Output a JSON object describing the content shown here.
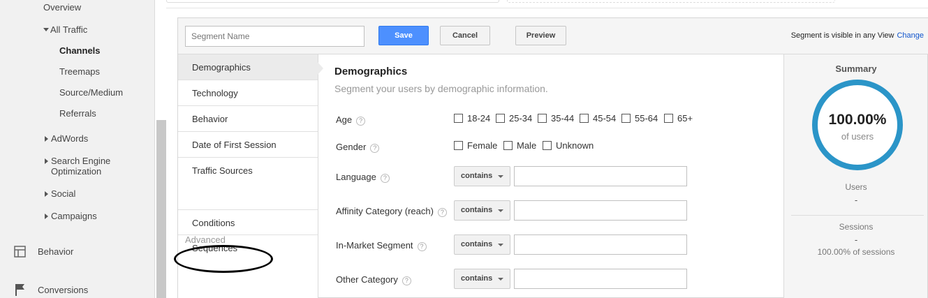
{
  "nav": {
    "overview": "Overview",
    "all_traffic": "All Traffic",
    "channels": "Channels",
    "treemaps": "Treemaps",
    "source_medium": "Source/Medium",
    "referrals": "Referrals",
    "adwords": "AdWords",
    "seo_line1": "Search Engine",
    "seo_line2": "Optimization",
    "social": "Social",
    "campaigns": "Campaigns",
    "behavior": "Behavior",
    "conversions": "Conversions",
    "behavior_icon": "layout-icon",
    "conversions_icon": "flag-icon"
  },
  "toolbar": {
    "segment_name_placeholder": "Segment Name",
    "save": "Save",
    "cancel": "Cancel",
    "preview": "Preview",
    "visibility_text": "Segment is visible in any View",
    "change": "Change"
  },
  "categories": {
    "items": [
      "Demographics",
      "Technology",
      "Behavior",
      "Date of First Session",
      "Traffic Sources"
    ],
    "advanced_label": "Advanced",
    "advanced_items": [
      "Conditions",
      "Sequences"
    ]
  },
  "demographics": {
    "title": "Demographics",
    "subtitle": "Segment your users by demographic information.",
    "help_glyph": "?",
    "age_label": "Age",
    "age_options": [
      "18-24",
      "25-34",
      "35-44",
      "45-54",
      "55-64",
      "65+"
    ],
    "gender_label": "Gender",
    "gender_options": [
      "Female",
      "Male",
      "Unknown"
    ],
    "language_label": "Language",
    "affinity_label": "Affinity Category (reach)",
    "inmarket_label": "In-Market Segment",
    "other_label": "Other Category",
    "match_value": "contains"
  },
  "summary": {
    "title": "Summary",
    "percent": "100.00%",
    "percent_sub": "of users",
    "users_label": "Users",
    "users_value": "-",
    "sessions_label": "Sessions",
    "sessions_value": "-",
    "sessions_pct": "100.00% of sessions",
    "ring_color": "#2b95c8"
  },
  "colors": {
    "save_button": "#4d90fe",
    "link": "#1155cc"
  }
}
